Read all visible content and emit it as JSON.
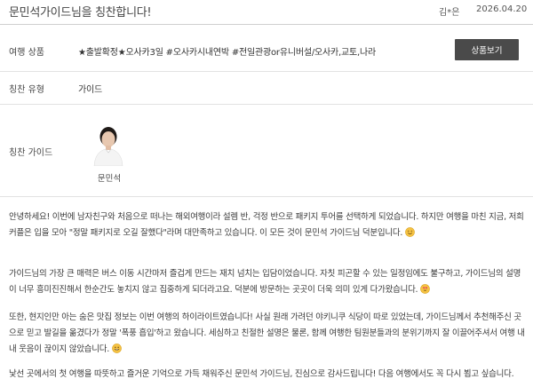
{
  "header": {
    "title": "문민석가이드님을 칭찬합니다!",
    "author": "김*은",
    "date": "2026.04.20"
  },
  "rows": {
    "product_label": "여행 상품",
    "product_value": "★출발확정★오사카3일 #오사카시내연박 #전일관광or유니버설/오사카,교토,나라",
    "product_button": "상품보기",
    "type_label": "칭찬 유형",
    "type_value": "가이드",
    "guide_label": "칭찬 가이드",
    "guide_name": "문민석"
  },
  "body": {
    "p1": "안녕하세요! 이번에 남자친구와 처음으로 떠나는 해외여행이라 설렘 반, 걱정 반으로 패키지 투어를 선택하게 되었습니다. 하지만 여행을 마친 지금, 저희 커플은 입을 모아 \"정말 패키지로 오길 잘했다\"라며 대만족하고 있습니다. 이 모든 것이 문민석 가이드님 덕분입니다.",
    "p2": "가이드님의 가장 큰 매력은 버스 이동 시간마저 즐겁게 만드는 재치 넘치는 입담이었습니다. 자칫 피곤할 수 있는 일정임에도 불구하고, 가이드님의 설명이 너무 흥미진진해서 한순간도 놓치지 않고 집중하게 되더라고요. 덕분에 방문하는 곳곳이 더욱 의미 있게 다가왔습니다.",
    "p3": "또한, 현지인만 아는 숨은 맛집 정보는 이번 여행의 하이라이트였습니다! 사실 원래 가려던 야키니쿠 식당이 따로 있었는데, 가이드님께서 추천해주신 곳으로 믿고 발길을 옮겼다가 정말 '폭풍 흡입'하고 왔습니다. 세심하고 친절한 설명은 물론, 함께 여행한 팀원분들과의 분위기까지 잘 이끌어주셔서 여행 내내 웃음이 끊이지 않았습니다.",
    "p4": "낯선 곳에서의 첫 여행을 따뜻하고 즐거운 기억으로 가득 채워주신 문민석 가이드님, 진심으로 감사드립니다! 다음 여행에서도 꼭 다시 뵙고 싶습니다."
  }
}
